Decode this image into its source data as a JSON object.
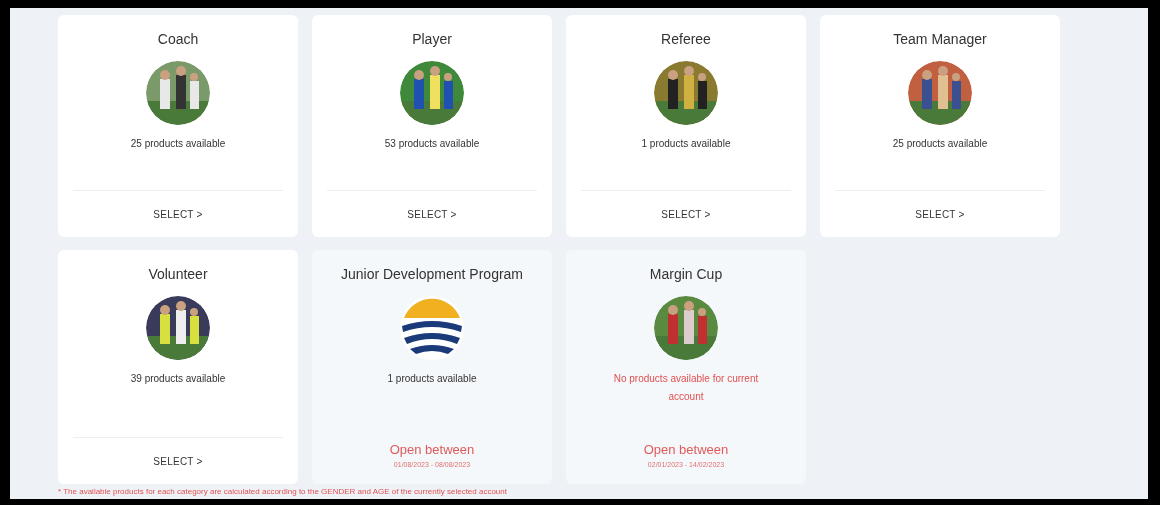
{
  "categories": [
    {
      "title": "Coach",
      "availability": "25 products available",
      "kind": "select",
      "action": "SELECT >",
      "available": true
    },
    {
      "title": "Player",
      "availability": "53 products available",
      "kind": "select",
      "action": "SELECT >",
      "available": true
    },
    {
      "title": "Referee",
      "availability": "1 products available",
      "kind": "select",
      "action": "SELECT >",
      "available": true
    },
    {
      "title": "Team Manager",
      "availability": "25 products available",
      "kind": "select",
      "action": "SELECT >",
      "available": true
    },
    {
      "title": "Volunteer",
      "availability": "39 products available",
      "kind": "select",
      "action": "SELECT >",
      "available": true
    },
    {
      "title": "Junior Development Program",
      "availability": "1 products available",
      "kind": "window",
      "open_label": "Open between",
      "open_dates": "01/08/2023 - 08/08/2023",
      "available": true
    },
    {
      "title": "Margin Cup",
      "availability": "No products available for current account",
      "kind": "window",
      "open_label": "Open between",
      "open_dates": "02/01/2023 - 14/02/2023",
      "available": false
    }
  ],
  "footnote": "* The available products for each category are calculated according to the GENDER and AGE of the currently selected account"
}
